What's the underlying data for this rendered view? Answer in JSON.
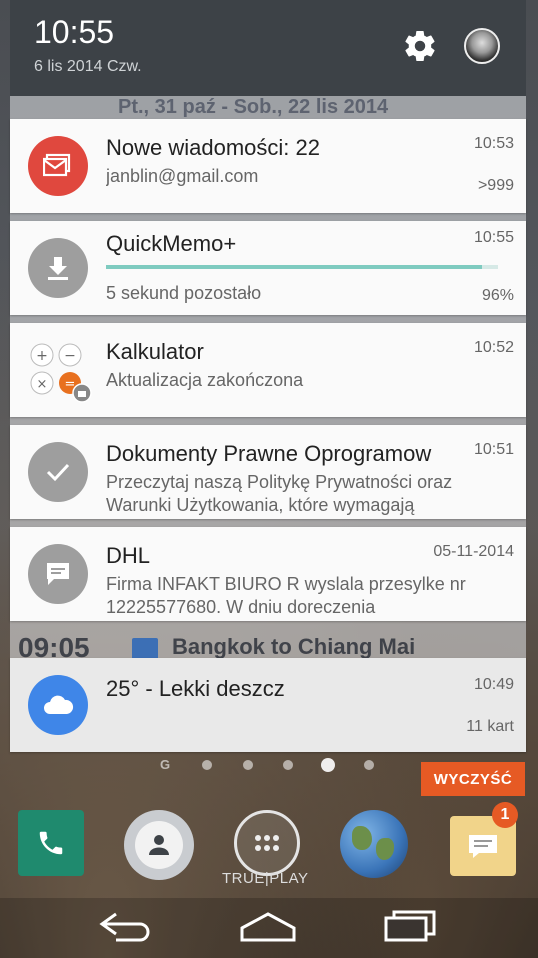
{
  "status": {
    "time": "10:55",
    "date": "6 lis 2014 Czw."
  },
  "background": {
    "calendar_range": "Pt., 31 paź - Sob., 22 lis 2014",
    "event_time": "09:05",
    "event_title": "Bangkok to Chiang Mai"
  },
  "notifications": [
    {
      "title": "Nowe wiadomości: 22",
      "subtitle": "janblin@gmail.com",
      "time": "10:53",
      "meta": ">999",
      "icon": "gmail-icon",
      "color": "#e0483e"
    },
    {
      "title": "QuickMemo+",
      "subtitle": "5 sekund pozostało",
      "time": "10:55",
      "meta": "96%",
      "progress": 0.96,
      "icon": "download-icon",
      "color": "#9e9e9e"
    },
    {
      "title": "Kalkulator",
      "subtitle": "Aktualizacja zakończona",
      "time": "10:52",
      "icon": "calculator-icon"
    },
    {
      "title": "Dokumenty Prawne Oprogramow",
      "line1": "Przeczytaj naszą Politykę Prywatności oraz",
      "line2": "Warunki Użytkowania, które wymagają",
      "time": "10:51",
      "icon": "check-icon",
      "color": "#9e9e9e"
    },
    {
      "title": "DHL",
      "line1": "Firma INFAKT BIURO R wyslala przesylke nr",
      "line2": "12225577680. W dniu doreczenia",
      "time": "05-11-2014",
      "icon": "message-icon",
      "color": "#9e9e9e"
    },
    {
      "title": "25° - Lekki deszcz",
      "time": "10:49",
      "meta": "11 kart",
      "icon": "cloud-icon",
      "color": "#3f86e8"
    }
  ],
  "clear_label": "WYCZYŚĆ",
  "dots_label": "G",
  "dock": {
    "play_label": "TRUE|PLAY",
    "badge": "1"
  },
  "colors": {
    "accent": "#e65a24",
    "progress": "#7fcbc0"
  }
}
